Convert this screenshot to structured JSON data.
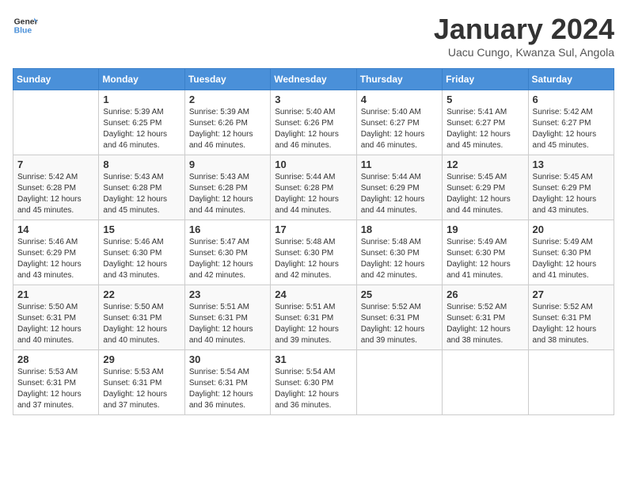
{
  "header": {
    "logo_line1": "General",
    "logo_line2": "Blue",
    "month_title": "January 2024",
    "subtitle": "Uacu Cungo, Kwanza Sul, Angola"
  },
  "days_of_week": [
    "Sunday",
    "Monday",
    "Tuesday",
    "Wednesday",
    "Thursday",
    "Friday",
    "Saturday"
  ],
  "weeks": [
    [
      {
        "day": "",
        "sunrise": "",
        "sunset": "",
        "daylight": ""
      },
      {
        "day": "1",
        "sunrise": "Sunrise: 5:39 AM",
        "sunset": "Sunset: 6:25 PM",
        "daylight": "Daylight: 12 hours and 46 minutes."
      },
      {
        "day": "2",
        "sunrise": "Sunrise: 5:39 AM",
        "sunset": "Sunset: 6:26 PM",
        "daylight": "Daylight: 12 hours and 46 minutes."
      },
      {
        "day": "3",
        "sunrise": "Sunrise: 5:40 AM",
        "sunset": "Sunset: 6:26 PM",
        "daylight": "Daylight: 12 hours and 46 minutes."
      },
      {
        "day": "4",
        "sunrise": "Sunrise: 5:40 AM",
        "sunset": "Sunset: 6:27 PM",
        "daylight": "Daylight: 12 hours and 46 minutes."
      },
      {
        "day": "5",
        "sunrise": "Sunrise: 5:41 AM",
        "sunset": "Sunset: 6:27 PM",
        "daylight": "Daylight: 12 hours and 45 minutes."
      },
      {
        "day": "6",
        "sunrise": "Sunrise: 5:42 AM",
        "sunset": "Sunset: 6:27 PM",
        "daylight": "Daylight: 12 hours and 45 minutes."
      }
    ],
    [
      {
        "day": "7",
        "sunrise": "Sunrise: 5:42 AM",
        "sunset": "Sunset: 6:28 PM",
        "daylight": "Daylight: 12 hours and 45 minutes."
      },
      {
        "day": "8",
        "sunrise": "Sunrise: 5:43 AM",
        "sunset": "Sunset: 6:28 PM",
        "daylight": "Daylight: 12 hours and 45 minutes."
      },
      {
        "day": "9",
        "sunrise": "Sunrise: 5:43 AM",
        "sunset": "Sunset: 6:28 PM",
        "daylight": "Daylight: 12 hours and 44 minutes."
      },
      {
        "day": "10",
        "sunrise": "Sunrise: 5:44 AM",
        "sunset": "Sunset: 6:28 PM",
        "daylight": "Daylight: 12 hours and 44 minutes."
      },
      {
        "day": "11",
        "sunrise": "Sunrise: 5:44 AM",
        "sunset": "Sunset: 6:29 PM",
        "daylight": "Daylight: 12 hours and 44 minutes."
      },
      {
        "day": "12",
        "sunrise": "Sunrise: 5:45 AM",
        "sunset": "Sunset: 6:29 PM",
        "daylight": "Daylight: 12 hours and 44 minutes."
      },
      {
        "day": "13",
        "sunrise": "Sunrise: 5:45 AM",
        "sunset": "Sunset: 6:29 PM",
        "daylight": "Daylight: 12 hours and 43 minutes."
      }
    ],
    [
      {
        "day": "14",
        "sunrise": "Sunrise: 5:46 AM",
        "sunset": "Sunset: 6:29 PM",
        "daylight": "Daylight: 12 hours and 43 minutes."
      },
      {
        "day": "15",
        "sunrise": "Sunrise: 5:46 AM",
        "sunset": "Sunset: 6:30 PM",
        "daylight": "Daylight: 12 hours and 43 minutes."
      },
      {
        "day": "16",
        "sunrise": "Sunrise: 5:47 AM",
        "sunset": "Sunset: 6:30 PM",
        "daylight": "Daylight: 12 hours and 42 minutes."
      },
      {
        "day": "17",
        "sunrise": "Sunrise: 5:48 AM",
        "sunset": "Sunset: 6:30 PM",
        "daylight": "Daylight: 12 hours and 42 minutes."
      },
      {
        "day": "18",
        "sunrise": "Sunrise: 5:48 AM",
        "sunset": "Sunset: 6:30 PM",
        "daylight": "Daylight: 12 hours and 42 minutes."
      },
      {
        "day": "19",
        "sunrise": "Sunrise: 5:49 AM",
        "sunset": "Sunset: 6:30 PM",
        "daylight": "Daylight: 12 hours and 41 minutes."
      },
      {
        "day": "20",
        "sunrise": "Sunrise: 5:49 AM",
        "sunset": "Sunset: 6:30 PM",
        "daylight": "Daylight: 12 hours and 41 minutes."
      }
    ],
    [
      {
        "day": "21",
        "sunrise": "Sunrise: 5:50 AM",
        "sunset": "Sunset: 6:31 PM",
        "daylight": "Daylight: 12 hours and 40 minutes."
      },
      {
        "day": "22",
        "sunrise": "Sunrise: 5:50 AM",
        "sunset": "Sunset: 6:31 PM",
        "daylight": "Daylight: 12 hours and 40 minutes."
      },
      {
        "day": "23",
        "sunrise": "Sunrise: 5:51 AM",
        "sunset": "Sunset: 6:31 PM",
        "daylight": "Daylight: 12 hours and 40 minutes."
      },
      {
        "day": "24",
        "sunrise": "Sunrise: 5:51 AM",
        "sunset": "Sunset: 6:31 PM",
        "daylight": "Daylight: 12 hours and 39 minutes."
      },
      {
        "day": "25",
        "sunrise": "Sunrise: 5:52 AM",
        "sunset": "Sunset: 6:31 PM",
        "daylight": "Daylight: 12 hours and 39 minutes."
      },
      {
        "day": "26",
        "sunrise": "Sunrise: 5:52 AM",
        "sunset": "Sunset: 6:31 PM",
        "daylight": "Daylight: 12 hours and 38 minutes."
      },
      {
        "day": "27",
        "sunrise": "Sunrise: 5:52 AM",
        "sunset": "Sunset: 6:31 PM",
        "daylight": "Daylight: 12 hours and 38 minutes."
      }
    ],
    [
      {
        "day": "28",
        "sunrise": "Sunrise: 5:53 AM",
        "sunset": "Sunset: 6:31 PM",
        "daylight": "Daylight: 12 hours and 37 minutes."
      },
      {
        "day": "29",
        "sunrise": "Sunrise: 5:53 AM",
        "sunset": "Sunset: 6:31 PM",
        "daylight": "Daylight: 12 hours and 37 minutes."
      },
      {
        "day": "30",
        "sunrise": "Sunrise: 5:54 AM",
        "sunset": "Sunset: 6:31 PM",
        "daylight": "Daylight: 12 hours and 36 minutes."
      },
      {
        "day": "31",
        "sunrise": "Sunrise: 5:54 AM",
        "sunset": "Sunset: 6:30 PM",
        "daylight": "Daylight: 12 hours and 36 minutes."
      },
      {
        "day": "",
        "sunrise": "",
        "sunset": "",
        "daylight": ""
      },
      {
        "day": "",
        "sunrise": "",
        "sunset": "",
        "daylight": ""
      },
      {
        "day": "",
        "sunrise": "",
        "sunset": "",
        "daylight": ""
      }
    ]
  ]
}
